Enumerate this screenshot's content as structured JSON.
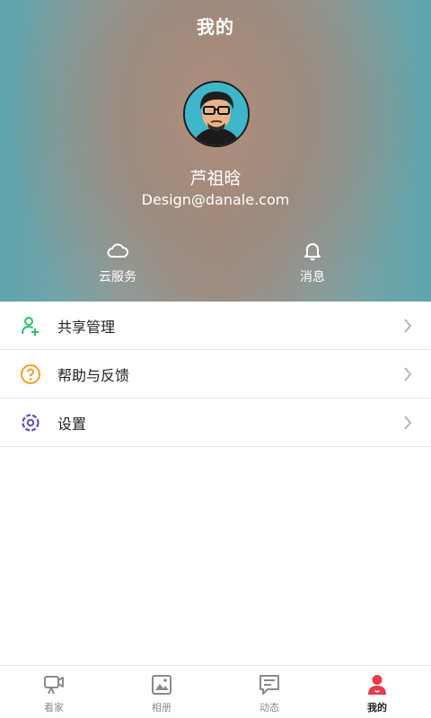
{
  "header": {
    "title": "我的",
    "username": "芦祖晗",
    "email": "Design@danale.com",
    "actions": [
      {
        "label": "云服务",
        "icon": "cloud-icon"
      },
      {
        "label": "消息",
        "icon": "bell-icon"
      }
    ]
  },
  "menu": [
    {
      "label": "共享管理",
      "icon": "share-user-icon",
      "color": "#2bbf6a"
    },
    {
      "label": "帮助与反馈",
      "icon": "help-icon",
      "color": "#f39c2a"
    },
    {
      "label": "设置",
      "icon": "settings-icon",
      "color": "#5a4fb8"
    }
  ],
  "tabs": [
    {
      "label": "看家",
      "icon": "camera-icon"
    },
    {
      "label": "相册",
      "icon": "album-icon"
    },
    {
      "label": "动态",
      "icon": "message-icon"
    },
    {
      "label": "我的",
      "icon": "profile-icon",
      "active": true
    }
  ],
  "colors": {
    "accent": "#e8394a",
    "inactive": "#8a8a8a",
    "divider": "#e8e8e8"
  }
}
